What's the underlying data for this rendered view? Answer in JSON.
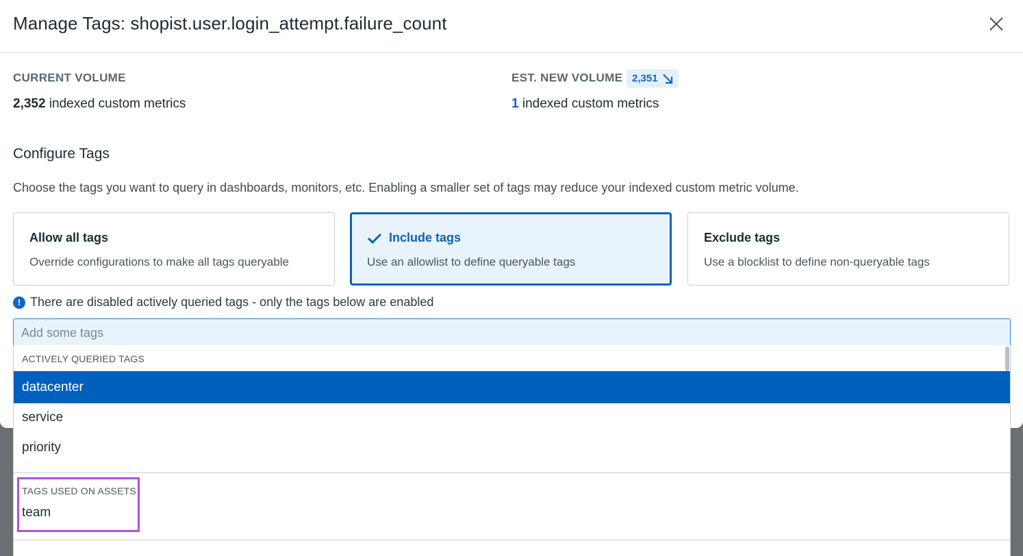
{
  "modal": {
    "title": "Manage Tags: shopist.user.login_attempt.failure_count",
    "close_icon": "close-icon"
  },
  "current_volume": {
    "label": "CURRENT VOLUME",
    "value": "2,352",
    "suffix": "indexed custom metrics"
  },
  "new_volume": {
    "label": "EST. NEW VOLUME",
    "badge_value": "2,351",
    "badge_icon": "arrow-down-right-icon",
    "value": "1",
    "suffix": "indexed custom metrics"
  },
  "configure": {
    "title": "Configure Tags",
    "description": "Choose the tags you want to query in dashboards, monitors, etc. Enabling a smaller set of tags may reduce your indexed custom metric volume."
  },
  "options": [
    {
      "title": "Allow all tags",
      "subtitle": "Override configurations to make all tags queryable",
      "selected": false
    },
    {
      "title": "Include tags",
      "subtitle": "Use an allowlist to define queryable tags",
      "selected": true
    },
    {
      "title": "Exclude tags",
      "subtitle": "Use a blocklist to define non-queryable tags",
      "selected": false
    }
  ],
  "notice": {
    "icon": "info-icon",
    "text": "There are disabled actively queried tags - only the tags below are enabled"
  },
  "tag_input": {
    "placeholder": "Add some tags"
  },
  "dropdown": {
    "actively_queried": {
      "label": "ACTIVELY QUERIED TAGS",
      "items": [
        "datacenter",
        "service",
        "priority"
      ]
    },
    "assets": {
      "label": "TAGS USED ON ASSETS",
      "items": [
        "team"
      ]
    }
  },
  "colors": {
    "accent": "#0060bd",
    "selected_card_border": "#0b62b8",
    "highlight_box": "#b44fe0"
  }
}
